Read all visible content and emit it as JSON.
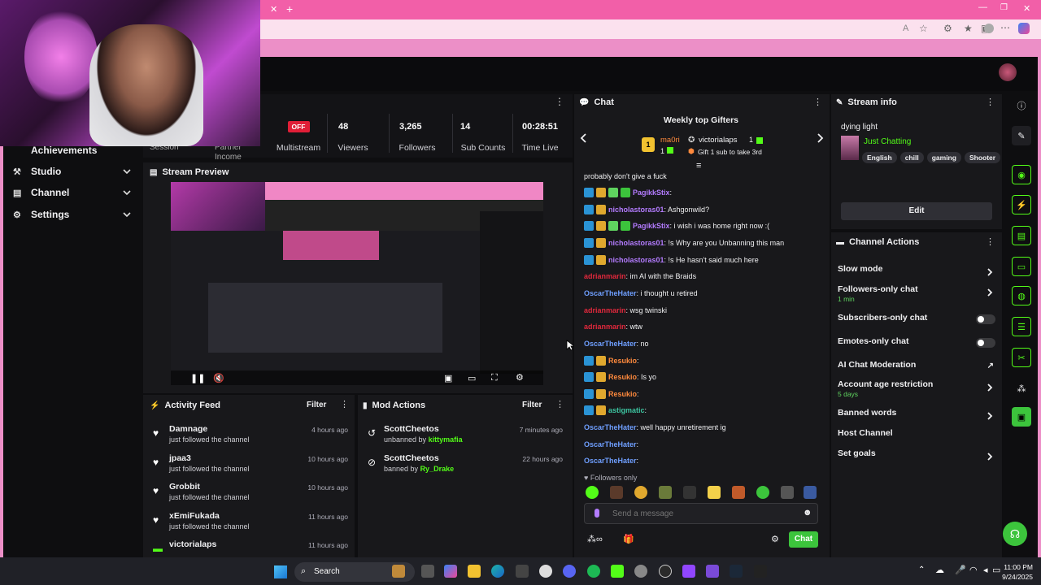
{
  "nav": {
    "items": [
      {
        "label": "Achievements"
      },
      {
        "label": "Studio"
      },
      {
        "label": "Channel"
      },
      {
        "label": "Settings"
      }
    ],
    "partial_labels": [
      "Session",
      "Partner Income"
    ]
  },
  "stats": {
    "multistream_badge": "OFF",
    "multistream_label": "Multistream",
    "viewers": {
      "value": "48",
      "label": "Viewers"
    },
    "followers": {
      "value": "3,265",
      "label": "Followers"
    },
    "subs": {
      "value": "14",
      "label": "Sub Counts"
    },
    "time": {
      "value": "00:28:51",
      "label": "Time Live"
    }
  },
  "preview": {
    "title": "Stream Preview"
  },
  "activity": {
    "title": "Activity Feed",
    "filter": "Filter",
    "items": [
      {
        "name": "Damnage",
        "action": "just followed the channel",
        "time": "4 hours ago"
      },
      {
        "name": "jpaa3",
        "action": "just followed the channel",
        "time": "10 hours ago"
      },
      {
        "name": "Grobbit",
        "action": "just followed the channel",
        "time": "10 hours ago"
      },
      {
        "name": "xEmiFukada",
        "action": "just followed the channel",
        "time": "11 hours ago"
      },
      {
        "name": "victorialaps",
        "action": "",
        "time": "11 hours ago"
      }
    ]
  },
  "mod": {
    "title": "Mod Actions",
    "filter": "Filter",
    "items": [
      {
        "name": "ScottCheetos",
        "action": "unbanned by",
        "by": "kittymafia",
        "time": "7 minutes ago"
      },
      {
        "name": "ScottCheetos",
        "action": "banned by",
        "by": "Ry_Drake",
        "time": "22 hours ago"
      }
    ]
  },
  "chat": {
    "title": "Chat",
    "gifters_title": "Weekly top Gifters",
    "gifter1": {
      "rank": "1",
      "name": "ma0ri",
      "count": "1"
    },
    "gifter2": {
      "name": "victorialaps",
      "count": "1",
      "note": "Gift 1 sub to take 3rd"
    },
    "lines": [
      {
        "user": "",
        "text": "probably don't give a fuck",
        "color": "#efeff1",
        "badges": []
      },
      {
        "user": "PagikkStix",
        "text": ":",
        "color": "#b47cff",
        "badges": [
          "mod",
          "crown",
          "star",
          "gift"
        ]
      },
      {
        "user": "nicholastoras01",
        "text": ": Ashgonwild?",
        "color": "#b47cff",
        "badges": [
          "mod",
          "crown"
        ]
      },
      {
        "user": "PagikkStix",
        "text": ": i wish i was home right now :(",
        "color": "#b47cff",
        "badges": [
          "mod",
          "crown",
          "star",
          "gift"
        ]
      },
      {
        "user": "nicholastoras01",
        "text": ": !s Why are you Unbanning this man",
        "color": "#b47cff",
        "badges": [
          "mod",
          "crown"
        ]
      },
      {
        "user": "nicholastoras01",
        "text": ": !s He hasn't said much here",
        "color": "#b47cff",
        "badges": [
          "mod",
          "crown"
        ]
      },
      {
        "user": "adrianmarin",
        "text": ": im AI with the Braids",
        "color": "#e0283c",
        "badges": []
      },
      {
        "user": "OscarTheHater",
        "text": ": i thought u retired",
        "color": "#6f9fff",
        "badges": []
      },
      {
        "user": "adrianmarin",
        "text": ": wsg twinski",
        "color": "#e0283c",
        "badges": []
      },
      {
        "user": "adrianmarin",
        "text": ": wtw",
        "color": "#e0283c",
        "badges": []
      },
      {
        "user": "OscarTheHater",
        "text": ": no",
        "color": "#6f9fff",
        "badges": []
      },
      {
        "user": "Resukio",
        "text": ":",
        "color": "#ff8a3d",
        "badges": [
          "mod",
          "crown"
        ]
      },
      {
        "user": "Resukio",
        "text": ": Is yo",
        "color": "#ff8a3d",
        "badges": [
          "mod",
          "crown"
        ]
      },
      {
        "user": "Resukio",
        "text": ":",
        "color": "#ff8a3d",
        "badges": [
          "mod",
          "crown"
        ]
      },
      {
        "user": "astigmatic",
        "text": ":",
        "color": "#3cc4a0",
        "badges": [
          "mod",
          "crown"
        ]
      },
      {
        "user": "OscarTheHater",
        "text": ": well happy unretirement ig",
        "color": "#6f9fff",
        "badges": []
      },
      {
        "user": "OscarTheHater",
        "text": ":",
        "color": "#6f9fff",
        "badges": []
      },
      {
        "user": "OscarTheHater",
        "text": ":",
        "color": "#6f9fff",
        "badges": []
      }
    ],
    "followers_only": "Followers only",
    "placeholder": "Send a message",
    "send": "Chat"
  },
  "stream_info": {
    "title": "Stream info",
    "stream_title": "dying light",
    "category": "Just Chatting",
    "tags": [
      "English",
      "chill",
      "gaming",
      "Shooter"
    ],
    "edit": "Edit"
  },
  "channel_actions": {
    "title": "Channel Actions",
    "items": [
      {
        "label": "Slow mode",
        "sub": "",
        "control": "chevron"
      },
      {
        "label": "Followers-only chat",
        "sub": "1 min",
        "control": "chevron"
      },
      {
        "label": "Subscribers-only chat",
        "sub": "",
        "control": "toggle"
      },
      {
        "label": "Emotes-only chat",
        "sub": "",
        "control": "toggle"
      },
      {
        "label": "AI Chat Moderation",
        "sub": "",
        "control": "external"
      },
      {
        "label": "Account age restriction",
        "sub": "5 days",
        "control": "chevron"
      },
      {
        "label": "Banned words",
        "sub": "",
        "control": "chevron"
      },
      {
        "label": "Host Channel",
        "sub": "",
        "control": "none"
      },
      {
        "label": "Set goals",
        "sub": "",
        "control": "chevron"
      }
    ]
  },
  "taskbar": {
    "search": "Search",
    "time": "11:00 PM",
    "date": "9/24/2025"
  },
  "colors": {
    "accent_green": "#53fc18",
    "chat_button": "#3cc43c",
    "browser_pink": "#f25fa8"
  }
}
